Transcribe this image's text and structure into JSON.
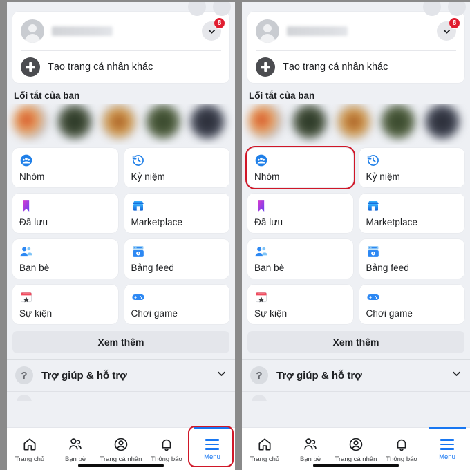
{
  "meta": {
    "panel_count": 2,
    "accent_blue": "#1877f2",
    "highlight_red": "#d01728",
    "badge_red": "#e01d30",
    "page_bg": "#eef0f4"
  },
  "profile": {
    "name_redacted": "",
    "badge_count": "8",
    "chevron_icon": "chevron-down-icon",
    "avatar_icon": "avatar-placeholder-icon",
    "create_profile_label": "Tạo trang cá nhân khác",
    "plus_icon": "plus-circle-icon"
  },
  "shortcuts": {
    "title": "Lối tắt của ban",
    "items": [
      {
        "name": "shortcut-1"
      },
      {
        "name": "shortcut-2"
      },
      {
        "name": "shortcut-3"
      },
      {
        "name": "shortcut-4"
      },
      {
        "name": "shortcut-5"
      }
    ]
  },
  "grid": {
    "tiles": [
      {
        "label": "Nhóm",
        "icon": "groups-icon"
      },
      {
        "label": "Kỷ niệm",
        "icon": "memories-clock-icon"
      },
      {
        "label": "Đã lưu",
        "icon": "saved-bookmark-icon"
      },
      {
        "label": "Marketplace",
        "icon": "marketplace-storefront-icon"
      },
      {
        "label": "Bạn bè",
        "icon": "friends-icon"
      },
      {
        "label": "Bảng feed",
        "icon": "feeds-icon"
      },
      {
        "label": "Sự kiện",
        "icon": "events-calendar-icon"
      },
      {
        "label": "Chơi game",
        "icon": "gaming-controller-icon"
      }
    ]
  },
  "see_more": {
    "label": "Xem thêm"
  },
  "help": {
    "label": "Trợ giúp & hỗ trợ",
    "icon": "question-mark-icon",
    "chevron_icon": "chevron-down-icon"
  },
  "bottom_nav": {
    "items": [
      {
        "label": "Trang chủ",
        "icon": "home-icon",
        "active": false
      },
      {
        "label": "Bạn bè",
        "icon": "friends-icon",
        "active": false
      },
      {
        "label": "Trang cá nhân",
        "icon": "profile-icon",
        "active": false
      },
      {
        "label": "Thông báo",
        "icon": "bell-icon",
        "active": false
      },
      {
        "label": "Menu",
        "icon": "hamburger-icon",
        "active": true
      }
    ]
  },
  "annotations": {
    "left_panel": {
      "target": "Menu",
      "shape": "rounded-rectangle",
      "color": "#d01728"
    },
    "right_panel": {
      "target": "Nhóm",
      "shape": "rounded-rectangle",
      "color": "#d01728"
    }
  }
}
